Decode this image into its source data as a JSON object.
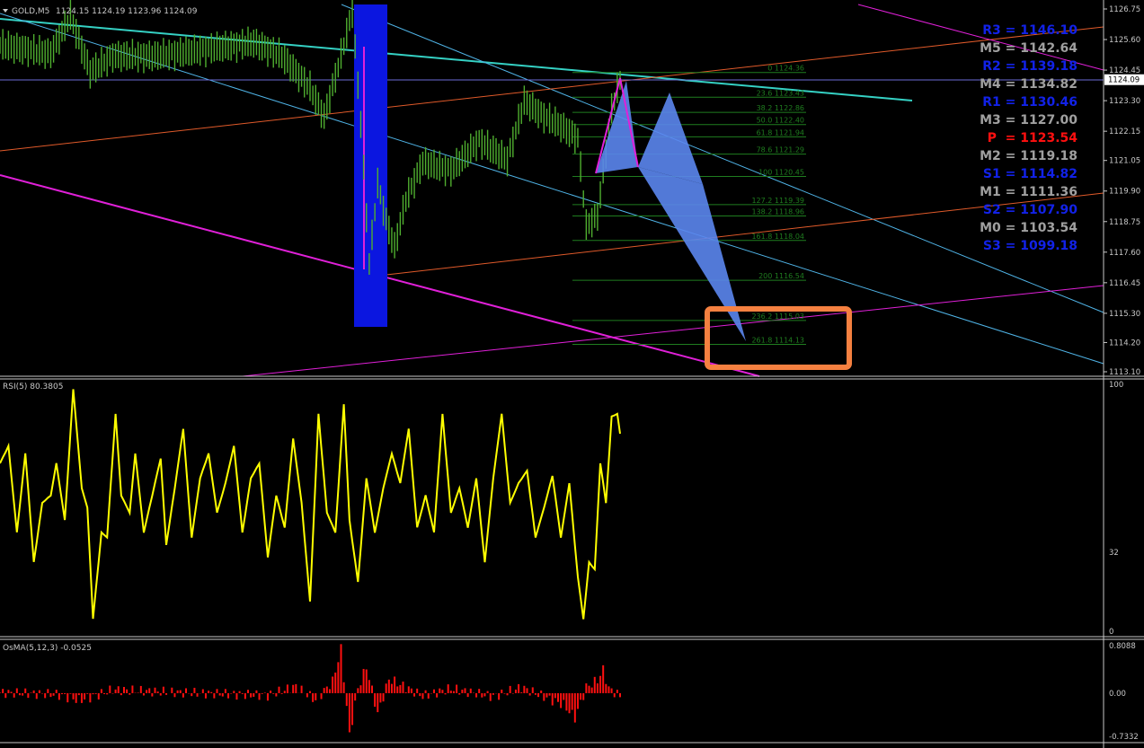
{
  "colors": {
    "background": "#000000",
    "price_bars": "#4fae2f",
    "fib_lines": "#1f7d1f",
    "rsi_line": "#ffff00",
    "osma_bars": "#ff1010",
    "harmonic_pattern": "#5b86ee",
    "highlight_box": "#f58040",
    "channel_cyan": "#35d1c4",
    "channel_blue": "#4fb3e6",
    "channel_orange": "#e05a2a",
    "channel_magenta": "#e020d8",
    "blue_zone": "#0b16e0",
    "pivot_blue": "#1222e8",
    "pivot_gray": "#a0a0a0",
    "pivot_red": "#ff1010",
    "axis_text": "#c8c8c8",
    "panel_border": "#c8c8c8"
  },
  "main": {
    "symbol_caption": "GOLD,M5",
    "ohlc_caption": "1124.15 1124.19 1123.96 1124.09",
    "current_price": "1124.09",
    "price_ticks": [
      "1126.75",
      "1125.60",
      "1124.45",
      "1123.30",
      "1122.15",
      "1121.05",
      "1119.90",
      "1118.75",
      "1117.60",
      "1116.45",
      "1115.30",
      "1114.20",
      "1113.10"
    ]
  },
  "pivots": [
    {
      "label": "R3 = 1146.10",
      "color": "#1222e8"
    },
    {
      "label": "M5 = 1142.64",
      "color": "#a0a0a0"
    },
    {
      "label": "R2 = 1139.18",
      "color": "#1222e8"
    },
    {
      "label": "M4 = 1134.82",
      "color": "#a0a0a0"
    },
    {
      "label": "R1 = 1130.46",
      "color": "#1222e8"
    },
    {
      "label": "M3 = 1127.00",
      "color": "#a0a0a0"
    },
    {
      "label": "P  = 1123.54",
      "color": "#ff1010"
    },
    {
      "label": "M2 = 1119.18",
      "color": "#a0a0a0"
    },
    {
      "label": "S1 = 1114.82",
      "color": "#1222e8"
    },
    {
      "label": "M1 = 1111.36",
      "color": "#a0a0a0"
    },
    {
      "label": "S2 = 1107.90",
      "color": "#1222e8"
    },
    {
      "label": "M0 = 1103.54",
      "color": "#a0a0a0"
    },
    {
      "label": "S3 = 1099.18",
      "color": "#1222e8"
    }
  ],
  "fib_levels": [
    "0 1124.36",
    "23.6 1123.43",
    "38.2 1122.86",
    "50.0 1122.40",
    "61.8 1121.94",
    "78.6 1121.29",
    "100 1120.45",
    "127.2 1119.39",
    "138.2 1118.96",
    "161.8 1118.04",
    "200 1116.54",
    "236.2 1115.03",
    "261.8 1114.13"
  ],
  "rsi": {
    "caption": "RSI(5) 80.3805",
    "ticks": [
      "100",
      "32",
      "0"
    ]
  },
  "osma": {
    "caption": "OsMA(5,12,3) -0.0525",
    "ticks": [
      "0.8088",
      "0.00",
      "-0.7332"
    ]
  },
  "chart_data": [
    {
      "type": "bar",
      "name": "price",
      "title": "GOLD,M5",
      "ylim": [
        1113.1,
        1126.75
      ],
      "points": 220,
      "value_anchors": [
        [
          0,
          1125.4
        ],
        [
          12,
          1125.2
        ],
        [
          18,
          1125.1
        ],
        [
          25,
          1126.5
        ],
        [
          32,
          1124.4
        ],
        [
          40,
          1125.0
        ],
        [
          55,
          1125.0
        ],
        [
          70,
          1125.2
        ],
        [
          90,
          1125.5
        ],
        [
          100,
          1125.0
        ],
        [
          110,
          1123.8
        ],
        [
          115,
          1122.7
        ],
        [
          120,
          1124.6
        ],
        [
          125,
          1126.7
        ],
        [
          128,
          1122.5
        ],
        [
          131,
          1117.2
        ],
        [
          134,
          1120.2
        ],
        [
          137,
          1118.8
        ],
        [
          140,
          1117.8
        ],
        [
          144,
          1119.6
        ],
        [
          150,
          1121.0
        ],
        [
          160,
          1120.7
        ],
        [
          170,
          1121.8
        ],
        [
          180,
          1121.1
        ],
        [
          186,
          1123.3
        ],
        [
          192,
          1122.8
        ],
        [
          200,
          1122.3
        ],
        [
          205,
          1121.9
        ],
        [
          208,
          1118.6
        ],
        [
          212,
          1119.0
        ],
        [
          214,
          1120.6
        ],
        [
          217,
          1123.0
        ],
        [
          220,
          1124.1
        ]
      ]
    },
    {
      "type": "line",
      "name": "RSI(5)",
      "ylim": [
        0,
        100
      ],
      "points": 220,
      "value_anchors": [
        [
          0,
          68
        ],
        [
          3,
          75
        ],
        [
          6,
          40
        ],
        [
          9,
          72
        ],
        [
          12,
          28
        ],
        [
          15,
          52
        ],
        [
          18,
          55
        ],
        [
          20,
          68
        ],
        [
          23,
          45
        ],
        [
          26,
          98
        ],
        [
          29,
          58
        ],
        [
          31,
          50
        ],
        [
          33,
          5
        ],
        [
          36,
          40
        ],
        [
          38,
          38
        ],
        [
          41,
          88
        ],
        [
          43,
          55
        ],
        [
          46,
          48
        ],
        [
          48,
          72
        ],
        [
          51,
          40
        ],
        [
          54,
          55
        ],
        [
          57,
          70
        ],
        [
          59,
          35
        ],
        [
          62,
          58
        ],
        [
          65,
          82
        ],
        [
          68,
          38
        ],
        [
          71,
          62
        ],
        [
          74,
          72
        ],
        [
          77,
          48
        ],
        [
          80,
          60
        ],
        [
          83,
          75
        ],
        [
          86,
          40
        ],
        [
          89,
          62
        ],
        [
          92,
          68
        ],
        [
          95,
          30
        ],
        [
          98,
          55
        ],
        [
          101,
          42
        ],
        [
          104,
          78
        ],
        [
          107,
          52
        ],
        [
          110,
          12
        ],
        [
          113,
          88
        ],
        [
          116,
          48
        ],
        [
          119,
          40
        ],
        [
          122,
          92
        ],
        [
          124,
          45
        ],
        [
          127,
          20
        ],
        [
          130,
          62
        ],
        [
          133,
          40
        ],
        [
          136,
          58
        ],
        [
          139,
          72
        ],
        [
          142,
          60
        ],
        [
          145,
          82
        ],
        [
          148,
          42
        ],
        [
          151,
          55
        ],
        [
          154,
          40
        ],
        [
          157,
          88
        ],
        [
          160,
          48
        ],
        [
          163,
          58
        ],
        [
          166,
          42
        ],
        [
          169,
          62
        ],
        [
          172,
          28
        ],
        [
          175,
          62
        ],
        [
          178,
          88
        ],
        [
          181,
          52
        ],
        [
          184,
          60
        ],
        [
          187,
          65
        ],
        [
          190,
          38
        ],
        [
          193,
          50
        ],
        [
          196,
          63
        ],
        [
          199,
          38
        ],
        [
          202,
          60
        ],
        [
          205,
          22
        ],
        [
          207,
          5
        ],
        [
          209,
          28
        ],
        [
          211,
          25
        ],
        [
          213,
          68
        ],
        [
          215,
          52
        ],
        [
          217,
          87
        ],
        [
          219,
          88
        ],
        [
          220,
          80
        ]
      ]
    },
    {
      "type": "bar",
      "name": "OsMA(5,12,3)",
      "ylim": [
        -0.7332,
        0.8088
      ],
      "points": 220,
      "value_anchors": [
        [
          0,
          0.01
        ],
        [
          20,
          -0.02
        ],
        [
          28,
          -0.12
        ],
        [
          33,
          -0.06
        ],
        [
          40,
          0.06
        ],
        [
          60,
          0.02
        ],
        [
          95,
          -0.04
        ],
        [
          105,
          0.12
        ],
        [
          112,
          -0.12
        ],
        [
          118,
          0.2
        ],
        [
          121,
          0.75
        ],
        [
          124,
          -0.72
        ],
        [
          127,
          0.08
        ],
        [
          130,
          0.45
        ],
        [
          134,
          -0.35
        ],
        [
          138,
          0.24
        ],
        [
          142,
          0.15
        ],
        [
          150,
          -0.05
        ],
        [
          160,
          0.08
        ],
        [
          175,
          -0.06
        ],
        [
          185,
          0.1
        ],
        [
          200,
          -0.2
        ],
        [
          204,
          -0.42
        ],
        [
          208,
          0.1
        ],
        [
          212,
          0.22
        ],
        [
          214,
          0.4
        ],
        [
          216,
          0.08
        ],
        [
          220,
          -0.05
        ]
      ]
    }
  ]
}
